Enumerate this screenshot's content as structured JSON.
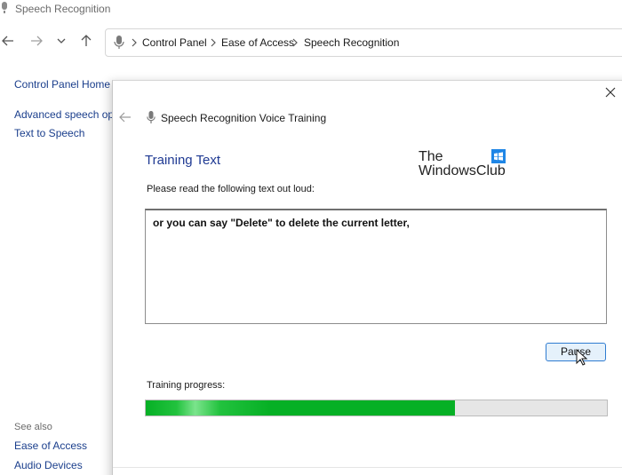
{
  "window": {
    "title": "Speech Recognition"
  },
  "address": {
    "crumbs": [
      "Control Panel",
      "Ease of Access",
      "Speech Recognition"
    ]
  },
  "left_pane": {
    "home_link": "Control Panel Home",
    "links": [
      "Advanced speech opti",
      "Text to Speech"
    ],
    "see_also_label": "See also",
    "see_also_links": [
      "Ease of Access",
      "Audio Devices"
    ]
  },
  "dialog": {
    "title": "Speech Recognition Voice Training",
    "section_title": "Training Text",
    "watermark": {
      "line1": "The",
      "line2": "WindowsClub"
    },
    "instruction": "Please read the following text out loud:",
    "training_text": "or you can say \"Delete\" to delete the current letter,",
    "pause_label": "Pause",
    "progress_label": "Training progress:",
    "progress_fraction": 0.67
  },
  "colors": {
    "link": "#1a3e8c",
    "section_title": "#1f3a93",
    "progress_fill": "#06b025",
    "button_border": "#2f7cd1"
  },
  "icons": [
    "microphone-icon",
    "back-arrow-icon",
    "forward-arrow-icon",
    "chevron-down-icon",
    "up-arrow-icon",
    "breadcrumb-separator-icon",
    "close-icon",
    "windows-logo-icon",
    "mouse-cursor-icon"
  ]
}
